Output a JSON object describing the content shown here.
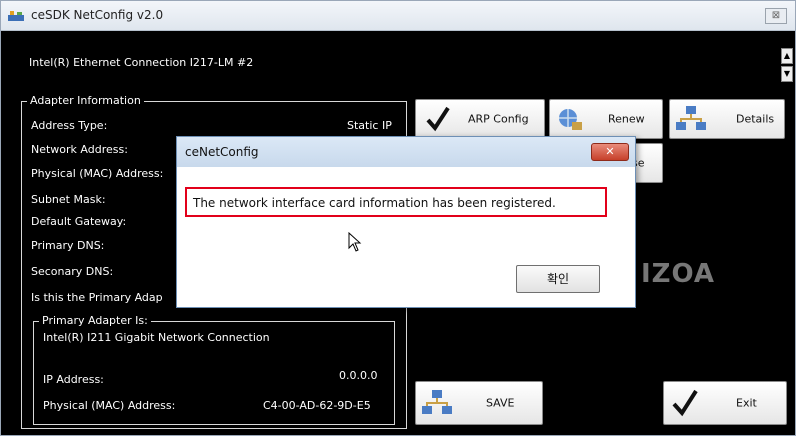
{
  "window": {
    "title": "ceSDK NetConfig v2.0",
    "close_symbol": "⊠"
  },
  "adapter_name": "Intel(R) Ethernet Connection I217-LM #2",
  "adapter_info": {
    "group_label": "Adapter Information",
    "labels": [
      "Address Type:",
      "Network Address:",
      "Physical (MAC) Address:",
      "Subnet Mask:",
      "Default Gateway:",
      "Primary DNS:",
      "Seconary DNS:",
      "Is this the Primary Adap"
    ],
    "address_type_value": "Static IP"
  },
  "primary_adapter": {
    "group_label": "Primary Adapter Is:",
    "name": "Intel(R) I211 Gigabit Network Connection",
    "ip_label": "IP Address:",
    "ip_value": "0.0.0.0",
    "mac_label": "Physical (MAC) Address:",
    "mac_value": "C4-00-AD-62-9D-E5"
  },
  "buttons": {
    "arp_config": "ARP Config",
    "renew": "Renew",
    "details": "Details",
    "release_fragment": "se",
    "save": "SAVE",
    "exit": "Exit"
  },
  "logo_text": "IZOA",
  "dialog": {
    "title": "ceNetConfig",
    "message": "The network interface card information has been registered.",
    "ok_label": "확인",
    "close_symbol": "✕"
  },
  "colors": {
    "highlight_border": "#e2001a",
    "background": "#000000"
  }
}
